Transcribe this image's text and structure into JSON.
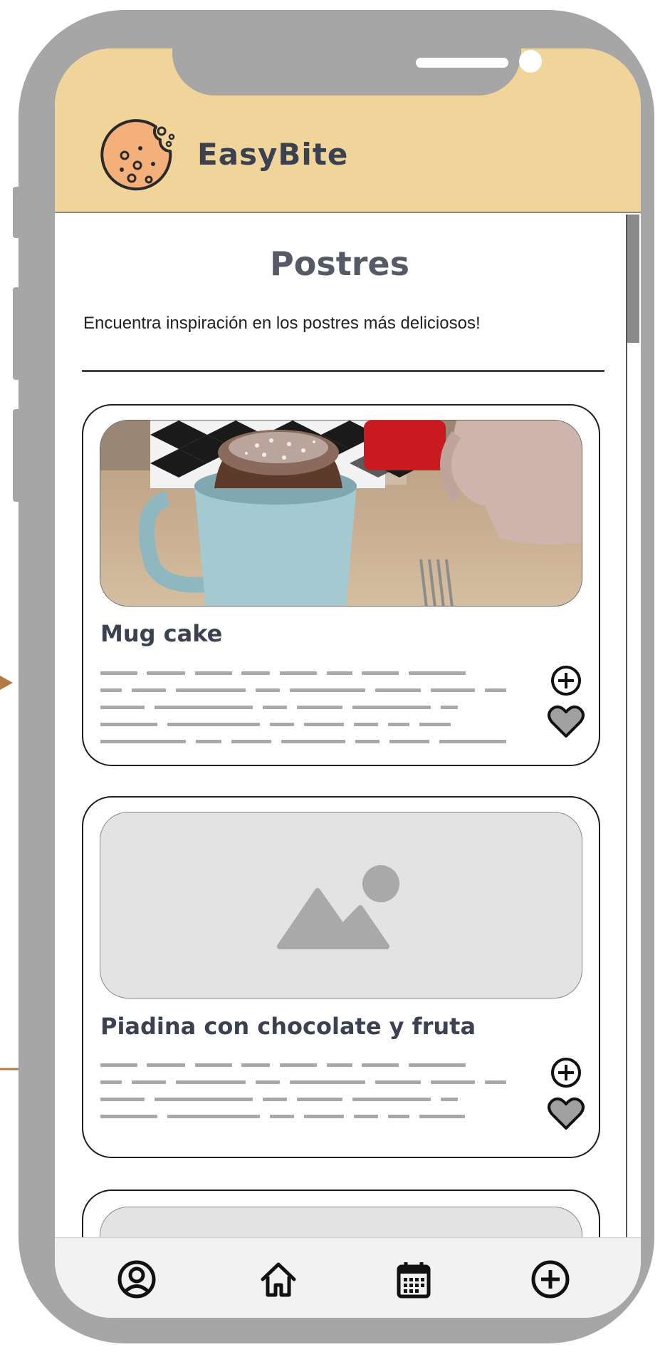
{
  "app": {
    "name": "EasyBite",
    "logo_icon": "cookie-icon"
  },
  "page": {
    "title": "Postres",
    "subtitle": "Encuentra inspiración en los postres más deliciosos!"
  },
  "cards": [
    {
      "title": "Mug cake",
      "image": "photo",
      "add_icon": "plus-circle-icon",
      "favorite_icon": "heart-icon"
    },
    {
      "title": "Piadina con chocolate y fruta",
      "image": "image-placeholder-icon",
      "add_icon": "plus-circle-icon",
      "favorite_icon": "heart-icon"
    }
  ],
  "bottom_nav": [
    {
      "icon": "user-icon"
    },
    {
      "icon": "home-icon"
    },
    {
      "icon": "calendar-icon"
    },
    {
      "icon": "plus-circle-icon"
    }
  ],
  "colors": {
    "header": "#f0d49a",
    "frame": "#a6a6a6",
    "text_dark": "#3b4150",
    "annotation_arrow": "#b27a45"
  }
}
